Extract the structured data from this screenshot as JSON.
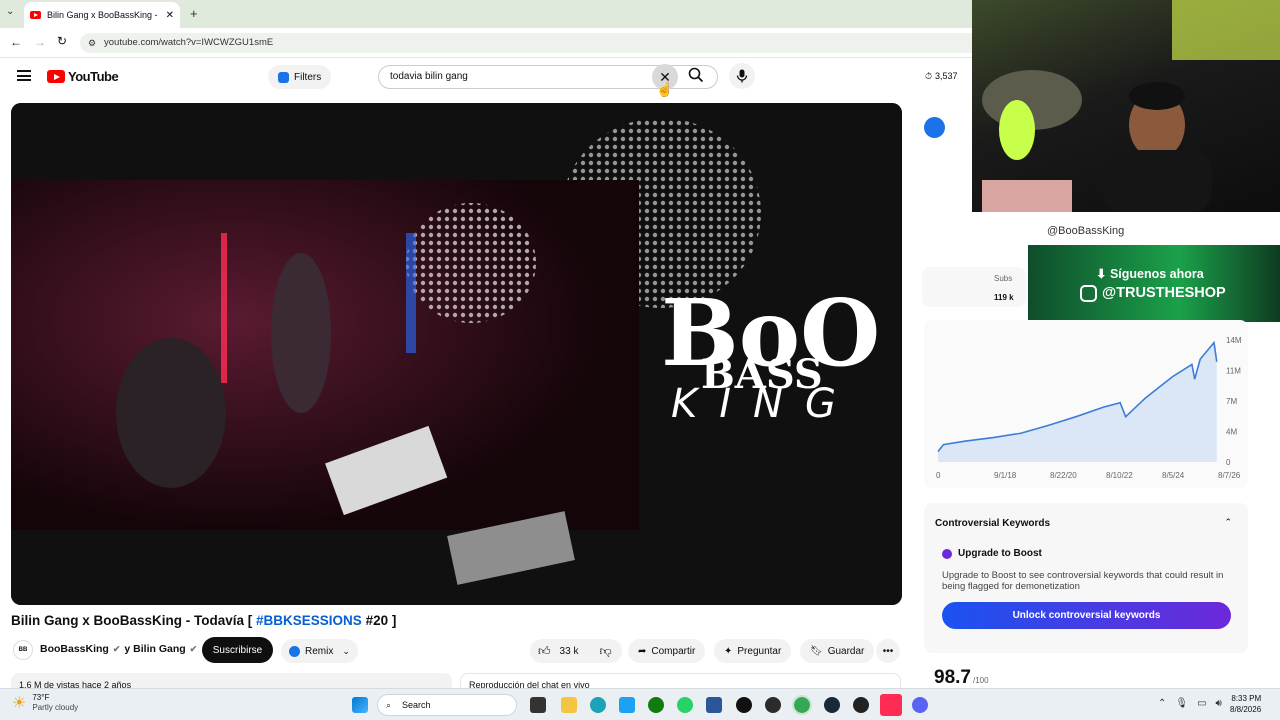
{
  "browser": {
    "tab_title": "Bilin Gang x BooBassKing - Todí",
    "url": "youtube.com/watch?v=IWCWZGU1smE"
  },
  "header": {
    "logo_text": "YouTube",
    "filters_label": "Filters",
    "search_value": "todavia bilin gang",
    "views_counter": "3,537"
  },
  "video": {
    "title_prefix": "Bilin Gang x BooBassKing - Todavía [ ",
    "title_hashtag": "#BBKSESSIONS",
    "title_suffix": " #20 ]",
    "logo_line1": "BoO",
    "logo_line2": "BASS",
    "logo_line3": "KING",
    "watermark": "✈"
  },
  "channel": {
    "name": "BooBassKing",
    "collab": "y Bilin Gang",
    "subscribe_label": "Suscribirse",
    "remix_label": "Remix",
    "avatar_initials": "BB"
  },
  "actions": {
    "likes": "33 k",
    "share": "Compartir",
    "ask": "Preguntar",
    "save": "Guardar"
  },
  "below": {
    "views_line": "1,6 M de vistas  hace 2 años",
    "chat_line": "Reproducción del chat en vivo"
  },
  "sidepanel": {
    "handle": "@BooBassKing",
    "subs_label": "Subs",
    "subs_value": "119 k",
    "promo_line1": "⬇ Síguenos ahora",
    "promo_line2": "@TRUSTHESHOP",
    "controversial_title": "Controversial Keywords",
    "upgrade_title": "Upgrade to Boost",
    "upgrade_desc": "Upgrade to Boost to see controversial keywords that could result in being flagged for demonetization",
    "unlock_label": "Unlock controversial keywords",
    "score": "98.7",
    "score_max": "/100"
  },
  "chart_data": {
    "type": "line",
    "x_ticks": [
      "0",
      "9/1/18",
      "8/22/20",
      "8/10/22",
      "8/5/24",
      "8/7/26"
    ],
    "y_ticks": [
      "14M",
      "11M",
      "7M",
      "4M",
      "0"
    ],
    "ylim": [
      0,
      14
    ],
    "series": [
      {
        "values": [
          [
            0,
            1.2
          ],
          [
            0.02,
            2
          ],
          [
            0.1,
            2.4
          ],
          [
            0.2,
            2.8
          ],
          [
            0.3,
            3.3
          ],
          [
            0.4,
            4.2
          ],
          [
            0.5,
            5.2
          ],
          [
            0.6,
            6.3
          ],
          [
            0.66,
            6.8
          ],
          [
            0.68,
            5.2
          ],
          [
            0.75,
            7.3
          ],
          [
            0.85,
            9.8
          ],
          [
            0.92,
            11.2
          ],
          [
            0.93,
            9.5
          ],
          [
            0.95,
            11.8
          ],
          [
            1,
            13.7
          ],
          [
            1.01,
            11.5
          ]
        ]
      }
    ]
  },
  "taskbar": {
    "weather_temp": "73°F",
    "weather_desc": "Partly cloudy",
    "search_placeholder": "Search",
    "time": "8:33 PM",
    "date": "8/8/2026"
  },
  "colors": {
    "accent_blue": "#1a73e8",
    "unlock_gradient_start": "#1a53f0",
    "unlock_gradient_end": "#6d28d9",
    "promo_green": "#1ba14a"
  }
}
